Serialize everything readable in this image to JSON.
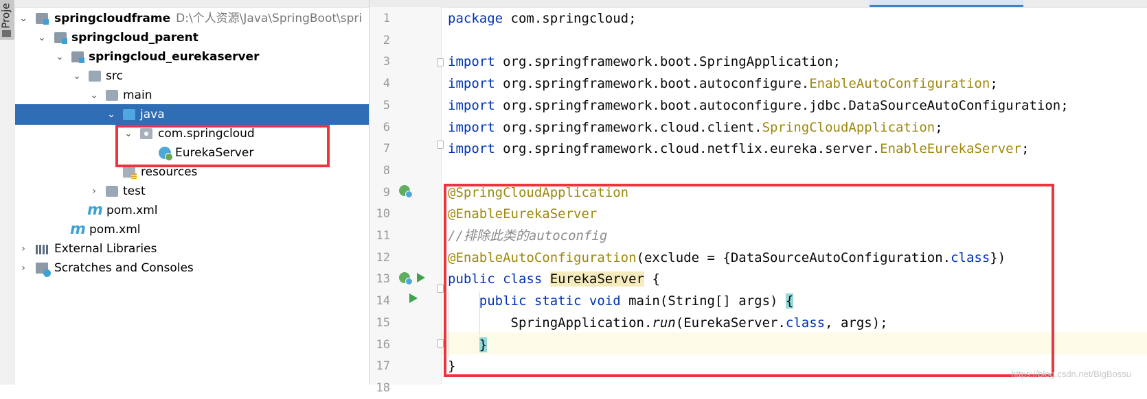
{
  "side_strip": {
    "label": "Proje"
  },
  "tree": {
    "rows": [
      {
        "label": "springcloudframe",
        "path": "D:\\个人资源\\Java\\SpringBoot\\spri"
      },
      {
        "label": "springcloud_parent"
      },
      {
        "label": "springcloud_eurekaserver"
      },
      {
        "label": "src"
      },
      {
        "label": "main"
      },
      {
        "label": "java"
      },
      {
        "label": "com.springcloud"
      },
      {
        "label": "EurekaServer"
      },
      {
        "label": "resources"
      },
      {
        "label": "test"
      },
      {
        "label": "pom.xml",
        "icon": "m"
      },
      {
        "label": "pom.xml",
        "icon": "m"
      },
      {
        "label": "External Libraries"
      },
      {
        "label": "Scratches and Consoles"
      }
    ]
  },
  "editor": {
    "lines": [
      {
        "n": "1",
        "t": [
          [
            "package",
            "kw"
          ],
          [
            " com.springcloud;",
            ""
          ]
        ]
      },
      {
        "n": "2",
        "t": []
      },
      {
        "n": "3",
        "t": [
          [
            "import",
            "kw"
          ],
          [
            " org.springframework.boot.SpringApplication;",
            ""
          ]
        ]
      },
      {
        "n": "4",
        "t": [
          [
            "import",
            "kw"
          ],
          [
            " org.springframework.boot.autoconfigure.",
            ""
          ],
          [
            "EnableAutoConfiguration",
            "ann"
          ],
          [
            ";",
            ""
          ]
        ]
      },
      {
        "n": "5",
        "t": [
          [
            "import",
            "kw"
          ],
          [
            " org.springframework.boot.autoconfigure.jdbc.DataSourceAutoConfiguration;",
            ""
          ]
        ]
      },
      {
        "n": "6",
        "t": [
          [
            "import",
            "kw"
          ],
          [
            " org.springframework.cloud.client.",
            ""
          ],
          [
            "SpringCloudApplication",
            "ann"
          ],
          [
            ";",
            ""
          ]
        ]
      },
      {
        "n": "7",
        "t": [
          [
            "import",
            "kw"
          ],
          [
            " org.springframework.cloud.netflix.eureka.server.",
            ""
          ],
          [
            "EnableEurekaServer",
            "ann"
          ],
          [
            ";",
            ""
          ]
        ]
      },
      {
        "n": "8",
        "t": []
      },
      {
        "n": "9",
        "t": [
          [
            "@SpringCloudApplication",
            "ann"
          ]
        ]
      },
      {
        "n": "10",
        "t": [
          [
            "@EnableEurekaServer",
            "ann"
          ]
        ]
      },
      {
        "n": "11",
        "t": [
          [
            "//排除此类的autoconfig",
            "cmt"
          ]
        ]
      },
      {
        "n": "12",
        "t": [
          [
            "@EnableAutoConfiguration",
            "ann"
          ],
          [
            "(exclude = {DataSourceAutoConfiguration.",
            ""
          ],
          [
            "class",
            "kw"
          ],
          [
            "})",
            ""
          ]
        ]
      },
      {
        "n": "13",
        "t": [
          [
            "public class ",
            "kw"
          ],
          [
            "EurekaServer",
            "hl"
          ],
          [
            " {",
            ""
          ]
        ]
      },
      {
        "n": "14",
        "t": [
          [
            "    ",
            ""
          ],
          [
            "public static void ",
            "kw"
          ],
          [
            "main",
            ""
          ],
          [
            "(String[] args) ",
            ""
          ],
          [
            "{",
            "br"
          ]
        ]
      },
      {
        "n": "15",
        "t": [
          [
            "        SpringApplication.",
            ""
          ],
          [
            "run",
            "it"
          ],
          [
            "(EurekaServer.",
            ""
          ],
          [
            "class",
            "kw"
          ],
          [
            ", args);",
            ""
          ]
        ]
      },
      {
        "n": "16",
        "t": [
          [
            "    ",
            ""
          ],
          [
            "}",
            "br"
          ]
        ]
      },
      {
        "n": "17",
        "t": [
          [
            "}",
            ""
          ]
        ]
      },
      {
        "n": "18",
        "t": []
      }
    ]
  },
  "watermark": "https://blog.csdn.net/BigBossu",
  "colors": {
    "highlight_box": "#f0323c",
    "selection": "#2f6db5",
    "keyword": "#0033b3",
    "annotation": "#9e880d"
  }
}
